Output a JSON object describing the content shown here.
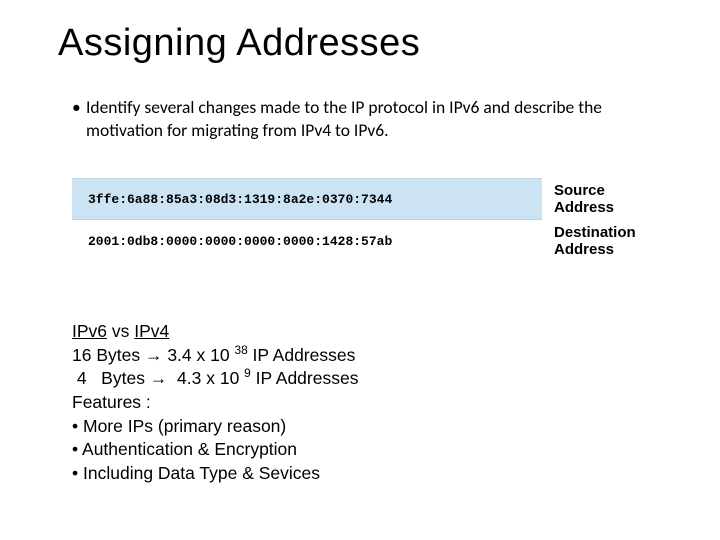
{
  "title": "Assigning Addresses",
  "main_bullet": "Identify several changes made to the IP protocol in IPv6 and describe the motivation for migrating from IPv4 to IPv6.",
  "addresses": {
    "source": {
      "value": "3ffe:6a88:85a3:08d3:1319:8a2e:0370:7344",
      "label": "Source Address"
    },
    "destination": {
      "value": "2001:0db8:0000:0000:0000:0000:1428:57ab",
      "label": "Destination Address"
    }
  },
  "comparison": {
    "heading_a": "IPv6",
    "heading_vs": " vs ",
    "heading_b": "IPv4",
    "line1_a": " 16 Bytes → 3.4 x 10 ",
    "line1_exp": "38",
    "line1_b": " IP Addresses",
    "line2_a": " 4   Bytes →  4.3 x 10 ",
    "line2_exp": "9",
    "line2_b": " IP Addresses",
    "features_label": "Features :",
    "features": [
      "More IPs (primary reason)",
      "Authentication & Encryption",
      "Including Data Type & Sevices"
    ]
  }
}
